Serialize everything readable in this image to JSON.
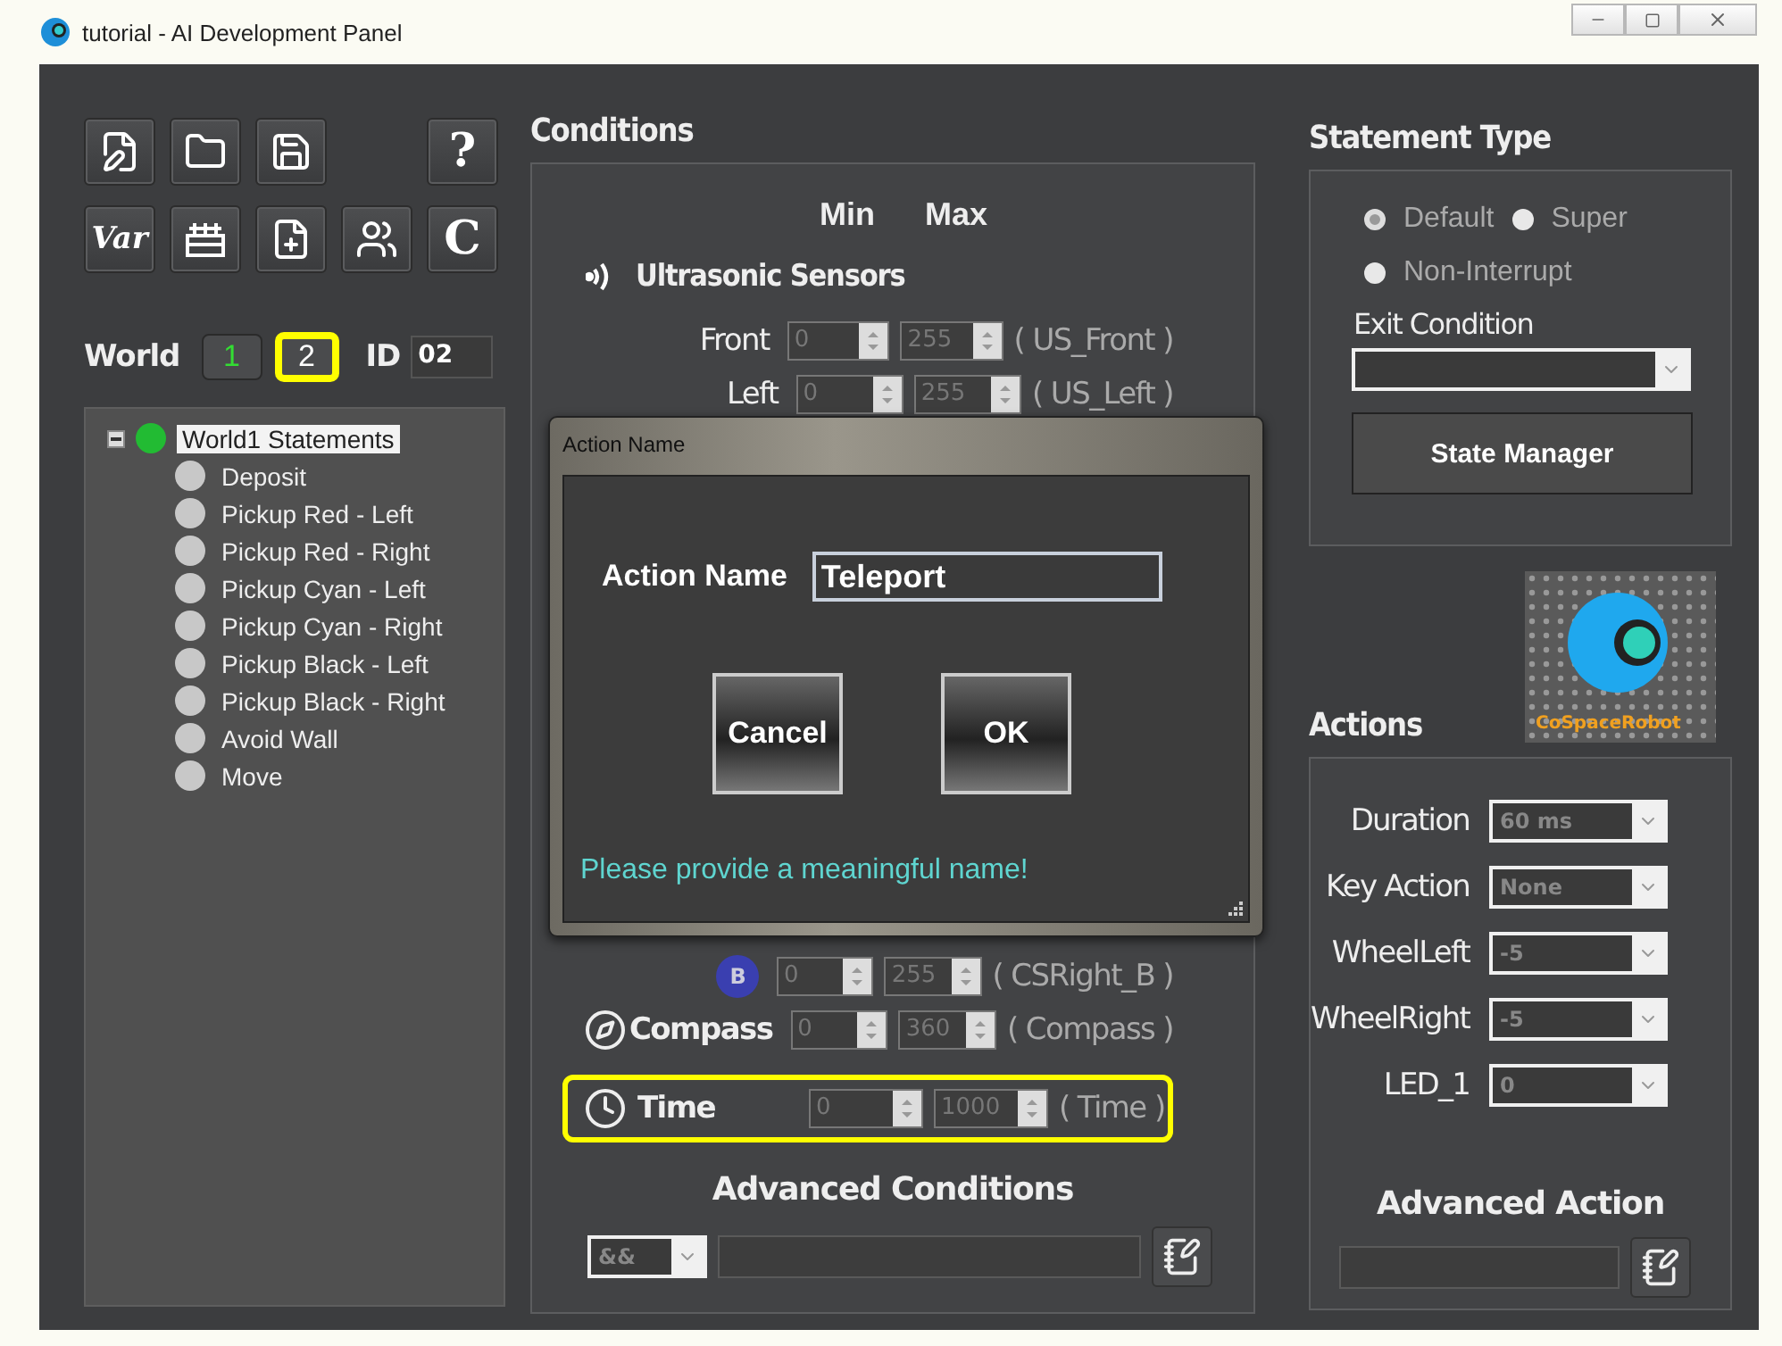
{
  "window": {
    "title": "tutorial - AI Development Panel"
  },
  "toolbar": {
    "rows": [
      [
        {
          "kind": "icon"
        },
        {
          "kind": "icon"
        },
        {
          "kind": "icon"
        },
        {
          "kind": "gap"
        },
        {
          "kind": "text",
          "label": "?"
        }
      ],
      [
        {
          "kind": "text",
          "label": "Var"
        },
        {
          "kind": "icon"
        },
        {
          "kind": "icon"
        },
        {
          "kind": "icon"
        },
        {
          "kind": "text",
          "label": "C"
        }
      ]
    ]
  },
  "world": {
    "label": "World",
    "buttons": [
      {
        "label": "1",
        "selected": true,
        "highlighted": false
      },
      {
        "label": "2",
        "selected": false,
        "highlighted": true
      }
    ],
    "id_label": "ID",
    "id_value": "02"
  },
  "tree": {
    "root": {
      "label": "World1 Statements",
      "active": true,
      "selected": true,
      "expanded": true,
      "children": [
        {
          "label": "Deposit",
          "active": false,
          "selected": false
        },
        {
          "label": "Pickup Red - Left",
          "active": false,
          "selected": false
        },
        {
          "label": "Pickup Red - Right",
          "active": false,
          "selected": false
        },
        {
          "label": "Pickup Cyan - Left",
          "active": false,
          "selected": false
        },
        {
          "label": "Pickup Cyan - Right",
          "active": false,
          "selected": false
        },
        {
          "label": "Pickup Black - Left",
          "active": false,
          "selected": false
        },
        {
          "label": "Pickup Black - Right",
          "active": false,
          "selected": false
        },
        {
          "label": "Avoid Wall",
          "active": false,
          "selected": false
        },
        {
          "label": "Move",
          "active": false,
          "selected": false
        }
      ]
    }
  },
  "conditions": {
    "title": "Conditions",
    "min_header": "Min",
    "max_header": "Max",
    "sensor_group": "Ultrasonic Sensors",
    "rows": [
      {
        "kind": "range",
        "label": "Front",
        "min": "0",
        "max": "255",
        "variable": "( US_Front )",
        "highlighted": false
      },
      {
        "kind": "range",
        "label": "Left",
        "min": "0",
        "max": "255",
        "variable": "( US_Left )",
        "highlighted": false
      }
    ],
    "lower_rows": [
      {
        "kind": "color",
        "label": "B",
        "min": "0",
        "max": "255",
        "variable": "( CSRight_B )",
        "highlighted": false
      },
      {
        "kind": "compass",
        "label": "Compass",
        "min": "0",
        "max": "360",
        "variable": "( Compass )",
        "highlighted": false
      },
      {
        "kind": "time",
        "label": "Time",
        "min": "0",
        "max": "1000",
        "variable": "( Time )",
        "highlighted": true
      }
    ],
    "advanced": {
      "title": "Advanced Conditions",
      "operator": "&&"
    }
  },
  "dialog": {
    "title": "Action Name",
    "label": "Action Name",
    "value": "Teleport",
    "buttons": [
      "Cancel",
      "OK"
    ],
    "hint": "Please provide a meaningful name!"
  },
  "statement_type": {
    "title": "Statement Type",
    "options": [
      {
        "label": "Default",
        "selected": true
      },
      {
        "label": "Super",
        "selected": false
      },
      {
        "label": "Non-Interrupt",
        "selected": false
      }
    ],
    "exit_label": "Exit Condition",
    "button": "State Manager"
  },
  "logo": {
    "text": "CoSpaceRobot"
  },
  "actions": {
    "title": "Actions",
    "rows": [
      {
        "label": "Duration",
        "value": "60 ms"
      },
      {
        "label": "Key Action",
        "value": "None"
      },
      {
        "label": "WheelLeft",
        "value": "-5"
      },
      {
        "label": "WheelRight",
        "value": "-5"
      },
      {
        "label": "LED_1",
        "value": "0"
      }
    ],
    "advanced_title": "Advanced Action"
  }
}
